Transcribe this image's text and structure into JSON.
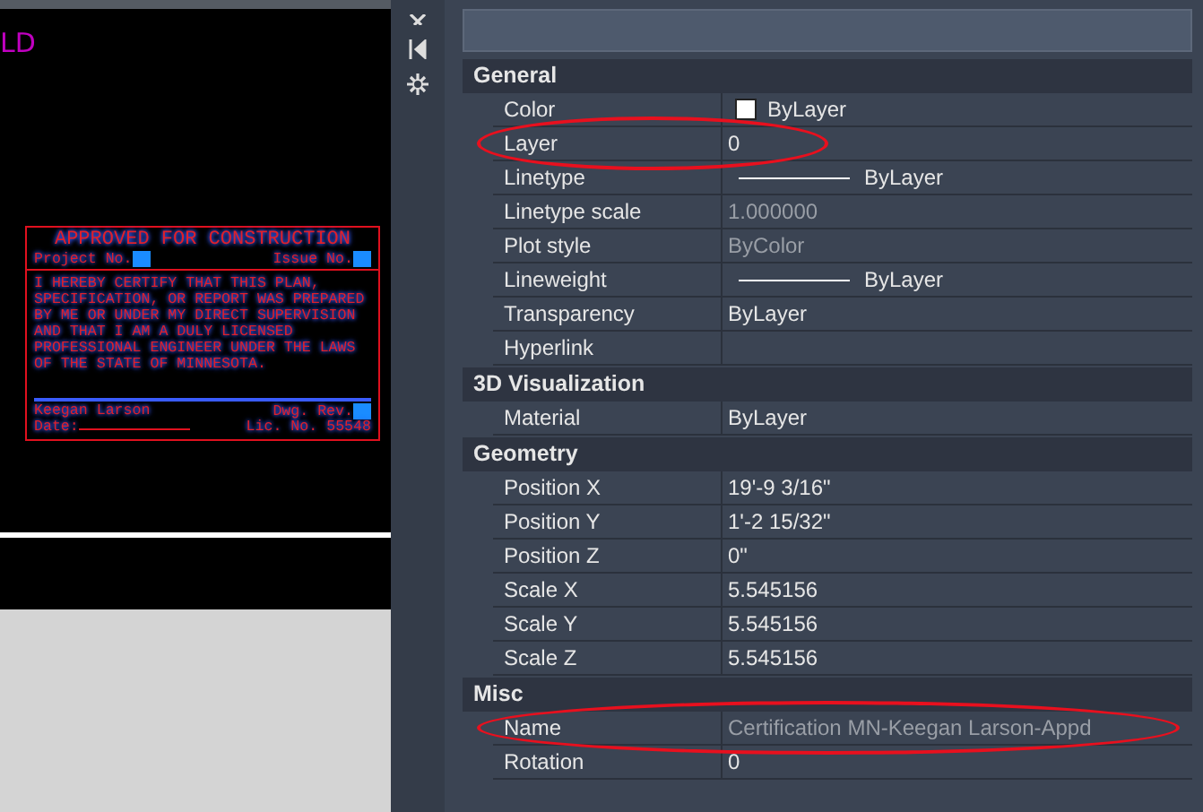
{
  "drawing": {
    "corner_text": "LD",
    "stamp": {
      "title": "APPROVED FOR CONSTRUCTION",
      "project_label": "Project No.",
      "issue_label": "Issue No.",
      "certification": "I HEREBY CERTIFY THAT THIS PLAN, SPECIFICATION, OR REPORT WAS PREPARED BY ME OR UNDER MY DIRECT SUPERVISION AND THAT I AM A DULY LICENSED PROFESSIONAL ENGINEER UNDER THE LAWS OF THE STATE OF MINNESOTA.",
      "signer": "Keegan Larson",
      "rev_label": "Dwg. Rev.",
      "date_label": "Date:",
      "license": "Lic. No. 55548"
    }
  },
  "properties": {
    "sections": [
      {
        "title": "General",
        "rows": [
          {
            "label": "Color",
            "value": "ByLayer",
            "kind": "color"
          },
          {
            "label": "Layer",
            "value": "0",
            "kind": "text",
            "circled": true
          },
          {
            "label": "Linetype",
            "value": "ByLayer",
            "kind": "line"
          },
          {
            "label": "Linetype scale",
            "value": "1.000000",
            "kind": "text",
            "disabled": true
          },
          {
            "label": "Plot style",
            "value": "ByColor",
            "kind": "text",
            "disabled": true
          },
          {
            "label": "Lineweight",
            "value": "ByLayer",
            "kind": "line"
          },
          {
            "label": "Transparency",
            "value": "ByLayer",
            "kind": "text"
          },
          {
            "label": "Hyperlink",
            "kind": "text"
          }
        ]
      },
      {
        "title": "3D Visualization",
        "rows": [
          {
            "label": "Material",
            "value": "ByLayer",
            "kind": "text"
          }
        ]
      },
      {
        "title": "Geometry",
        "rows": [
          {
            "label": "Position X",
            "value": "19'-9 3/16\"",
            "kind": "text"
          },
          {
            "label": "Position Y",
            "value": "1'-2 15/32\"",
            "kind": "text"
          },
          {
            "label": "Position Z",
            "value": "0\"",
            "kind": "text"
          },
          {
            "label": "Scale X",
            "value": "5.545156",
            "kind": "text"
          },
          {
            "label": "Scale Y",
            "value": "5.545156",
            "kind": "text"
          },
          {
            "label": "Scale Z",
            "value": "5.545156",
            "kind": "text"
          }
        ]
      },
      {
        "title": "Misc",
        "rows": [
          {
            "label": "Name",
            "value": "Certification MN-Keegan Larson-Appd",
            "kind": "text",
            "disabled": true,
            "circled": true
          },
          {
            "label": "Rotation",
            "value": "0",
            "kind": "text"
          }
        ]
      }
    ]
  }
}
